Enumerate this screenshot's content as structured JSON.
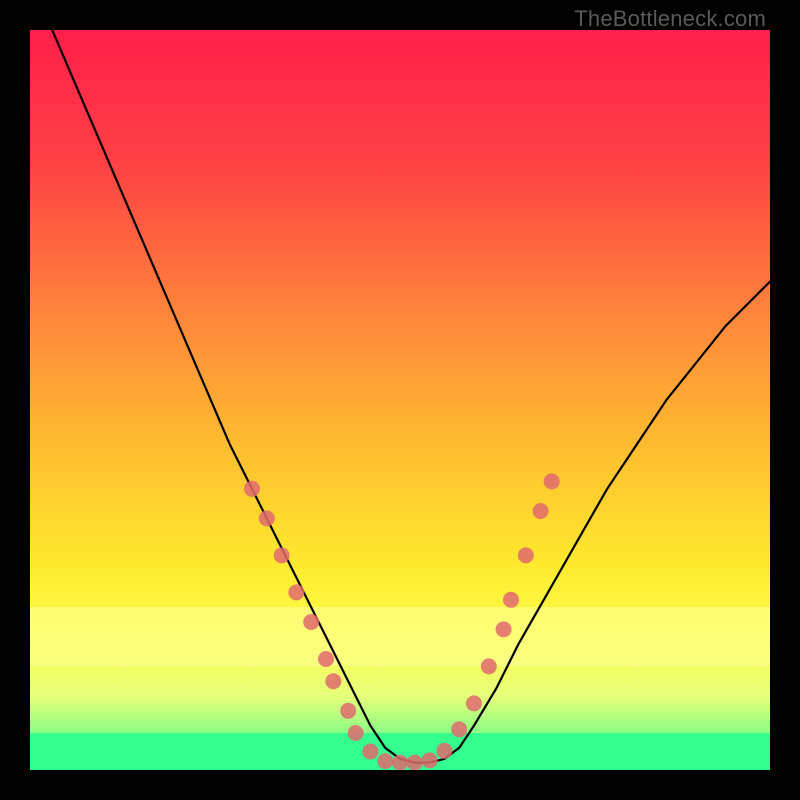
{
  "watermark_text": "TheBottleneck.com",
  "chart_data": {
    "type": "line",
    "title": "",
    "xlabel": "",
    "ylabel": "",
    "xlim": [
      0,
      100
    ],
    "ylim": [
      0,
      100
    ],
    "gradient_stops": [
      {
        "offset": 0,
        "color": "#ff1f4b"
      },
      {
        "offset": 18,
        "color": "#ff4144"
      },
      {
        "offset": 40,
        "color": "#ff8a3a"
      },
      {
        "offset": 58,
        "color": "#ffc22f"
      },
      {
        "offset": 72,
        "color": "#ffe92e"
      },
      {
        "offset": 82,
        "color": "#fcff4a"
      },
      {
        "offset": 90,
        "color": "#e6ff7a"
      },
      {
        "offset": 100,
        "color": "#2fff8f"
      }
    ],
    "overlay_bands": [
      {
        "y_from": 78,
        "y_to": 86,
        "color": "#ffff9a",
        "opacity": 0.55
      },
      {
        "y_from": 95,
        "y_to": 100,
        "color": "#2fff8f",
        "opacity": 0.9
      }
    ],
    "series": [
      {
        "name": "bottleneck-curve",
        "color": "#000000",
        "width": 2.2,
        "x": [
          3,
          6,
          9,
          12,
          15,
          18,
          21,
          24,
          27,
          30,
          33,
          36,
          38,
          40,
          42,
          44,
          46,
          48,
          50,
          52,
          54,
          56,
          58,
          60,
          63,
          66,
          70,
          74,
          78,
          82,
          86,
          90,
          94,
          98,
          100
        ],
        "y": [
          100,
          93,
          86,
          79,
          72,
          65,
          58,
          51,
          44,
          38,
          32,
          26,
          22,
          18,
          14,
          10,
          6,
          3,
          1.5,
          1,
          1,
          1.5,
          3,
          6,
          11,
          17,
          24,
          31,
          38,
          44,
          50,
          55,
          60,
          64,
          66
        ]
      }
    ],
    "markers": {
      "color": "#e06a6f",
      "radius": 8,
      "points": [
        {
          "x": 30,
          "y": 38
        },
        {
          "x": 32,
          "y": 34
        },
        {
          "x": 34,
          "y": 29
        },
        {
          "x": 36,
          "y": 24
        },
        {
          "x": 38,
          "y": 20
        },
        {
          "x": 40,
          "y": 15
        },
        {
          "x": 41,
          "y": 12
        },
        {
          "x": 43,
          "y": 8
        },
        {
          "x": 44,
          "y": 5
        },
        {
          "x": 46,
          "y": 2.5
        },
        {
          "x": 48,
          "y": 1.2
        },
        {
          "x": 50,
          "y": 1
        },
        {
          "x": 52,
          "y": 1
        },
        {
          "x": 54,
          "y": 1.3
        },
        {
          "x": 56,
          "y": 2.6
        },
        {
          "x": 58,
          "y": 5.5
        },
        {
          "x": 60,
          "y": 9
        },
        {
          "x": 62,
          "y": 14
        },
        {
          "x": 64,
          "y": 19
        },
        {
          "x": 65,
          "y": 23
        },
        {
          "x": 67,
          "y": 29
        },
        {
          "x": 69,
          "y": 35
        },
        {
          "x": 70.5,
          "y": 39
        }
      ]
    }
  }
}
